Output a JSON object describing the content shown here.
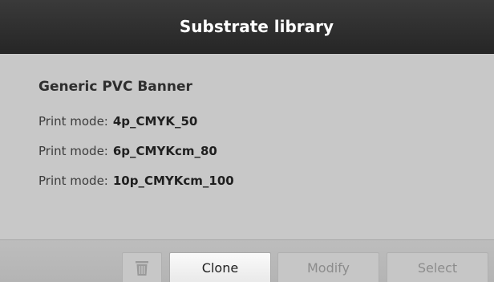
{
  "window": {
    "title": "Substrate library"
  },
  "substrate": {
    "name": "Generic PVC Banner",
    "print_mode_label": "Print mode:",
    "modes": [
      "4p_CMYK_50",
      "6p_CMYKcm_80",
      "10p_CMYKcm_100"
    ]
  },
  "footer": {
    "delete_icon": "trash-icon",
    "clone_label": "Clone",
    "modify_label": "Modify",
    "select_label": "Select",
    "modify_enabled": false,
    "select_enabled": false,
    "delete_enabled": false
  },
  "colors": {
    "titlebar": "#2e2e2e",
    "panel": "#c8c8c8",
    "disabled_text": "#8c8c8c"
  }
}
